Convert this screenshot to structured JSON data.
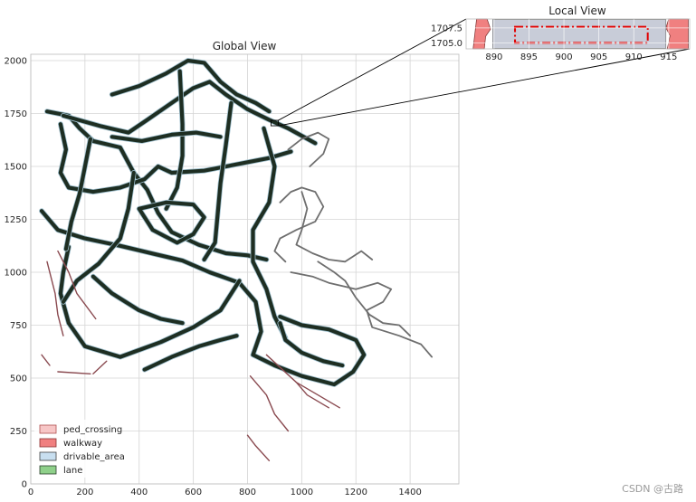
{
  "watermark": "CSDN @古路",
  "chart_data": [
    {
      "name": "global",
      "type": "map",
      "title": "Global View",
      "xlim": [
        0,
        1580
      ],
      "ylim": [
        0,
        2030
      ],
      "xticks": [
        0,
        200,
        400,
        600,
        800,
        1000,
        1200,
        1400
      ],
      "yticks": [
        0,
        250,
        500,
        750,
        1000,
        1250,
        1500,
        1750,
        2000
      ],
      "grid": true,
      "legend_position": "lower-left",
      "legend": [
        {
          "label": "ped_crossing",
          "fill": "#f7c6c6",
          "edge": "#b05050"
        },
        {
          "label": "walkway",
          "fill": "#f08080",
          "edge": "#8a3030"
        },
        {
          "label": "drivable_area",
          "fill": "#c8dff0",
          "edge": "#404040"
        },
        {
          "label": "lane",
          "fill": "#8fd08a",
          "edge": "#2a402a"
        }
      ],
      "colors": {
        "road": "#1e2e22",
        "road_outline": "#9fc0cf",
        "walkway": "#8a4a50",
        "periphery": "#6e6e6e"
      },
      "inset_anchor": {
        "x": 900,
        "y": 1705
      }
    },
    {
      "name": "local",
      "type": "map",
      "title": "Local View",
      "xlim": [
        886,
        918
      ],
      "ylim": [
        1704,
        1709
      ],
      "xticks": [
        890,
        895,
        900,
        905,
        910,
        915
      ],
      "yticks": [
        1705.0,
        1707.5
      ],
      "grid": true,
      "walkway_fill": "#f08080",
      "drivable_fill": "#c8ccd8",
      "highlight_color": "#e00000",
      "highlight_box": [
        883,
        1705.0,
        912,
        1707.7
      ]
    }
  ]
}
